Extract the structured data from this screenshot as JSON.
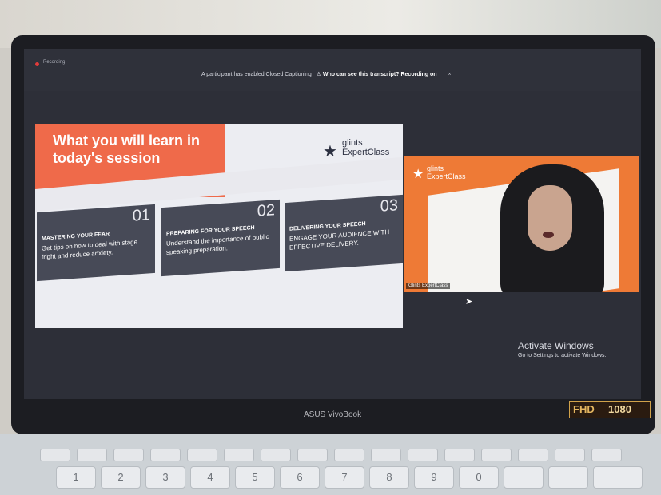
{
  "zoom_bar": {
    "top_small": "Recording",
    "banner_text": "A participant has enabled Closed Captioning",
    "banner_link": "Who can see this transcript? Recording on",
    "banner_close": "×"
  },
  "slide": {
    "title": "What you will learn in today's session",
    "brand_line1": "glints",
    "brand_line2": "ExpertClass",
    "cards": [
      {
        "num": "01",
        "head": "MASTERING YOUR FEAR",
        "desc": "Get tips on how to deal with stage fright and reduce anxiety."
      },
      {
        "num": "02",
        "head": "PREPARING FOR YOUR SPEECH",
        "desc": "Understand the importance of public speaking preparation."
      },
      {
        "num": "03",
        "head": "DELIVERING YOUR SPEECH",
        "desc": "ENGAGE YOUR AUDIENCE WITH EFFECTIVE DELIVERY."
      }
    ]
  },
  "video": {
    "brand_line1": "glints",
    "brand_line2": "ExpertClass",
    "name_tag": "Glints ExpertClass"
  },
  "windows": {
    "activate_title": "Activate Windows",
    "activate_sub": "Go to Settings to activate Windows."
  },
  "laptop": {
    "brand": "ASUS VivoBook",
    "badge_left": "FHD",
    "badge_right": "1080"
  },
  "keys": [
    "1",
    "2",
    "3",
    "4",
    "5",
    "6",
    "7",
    "8",
    "9",
    "0"
  ]
}
